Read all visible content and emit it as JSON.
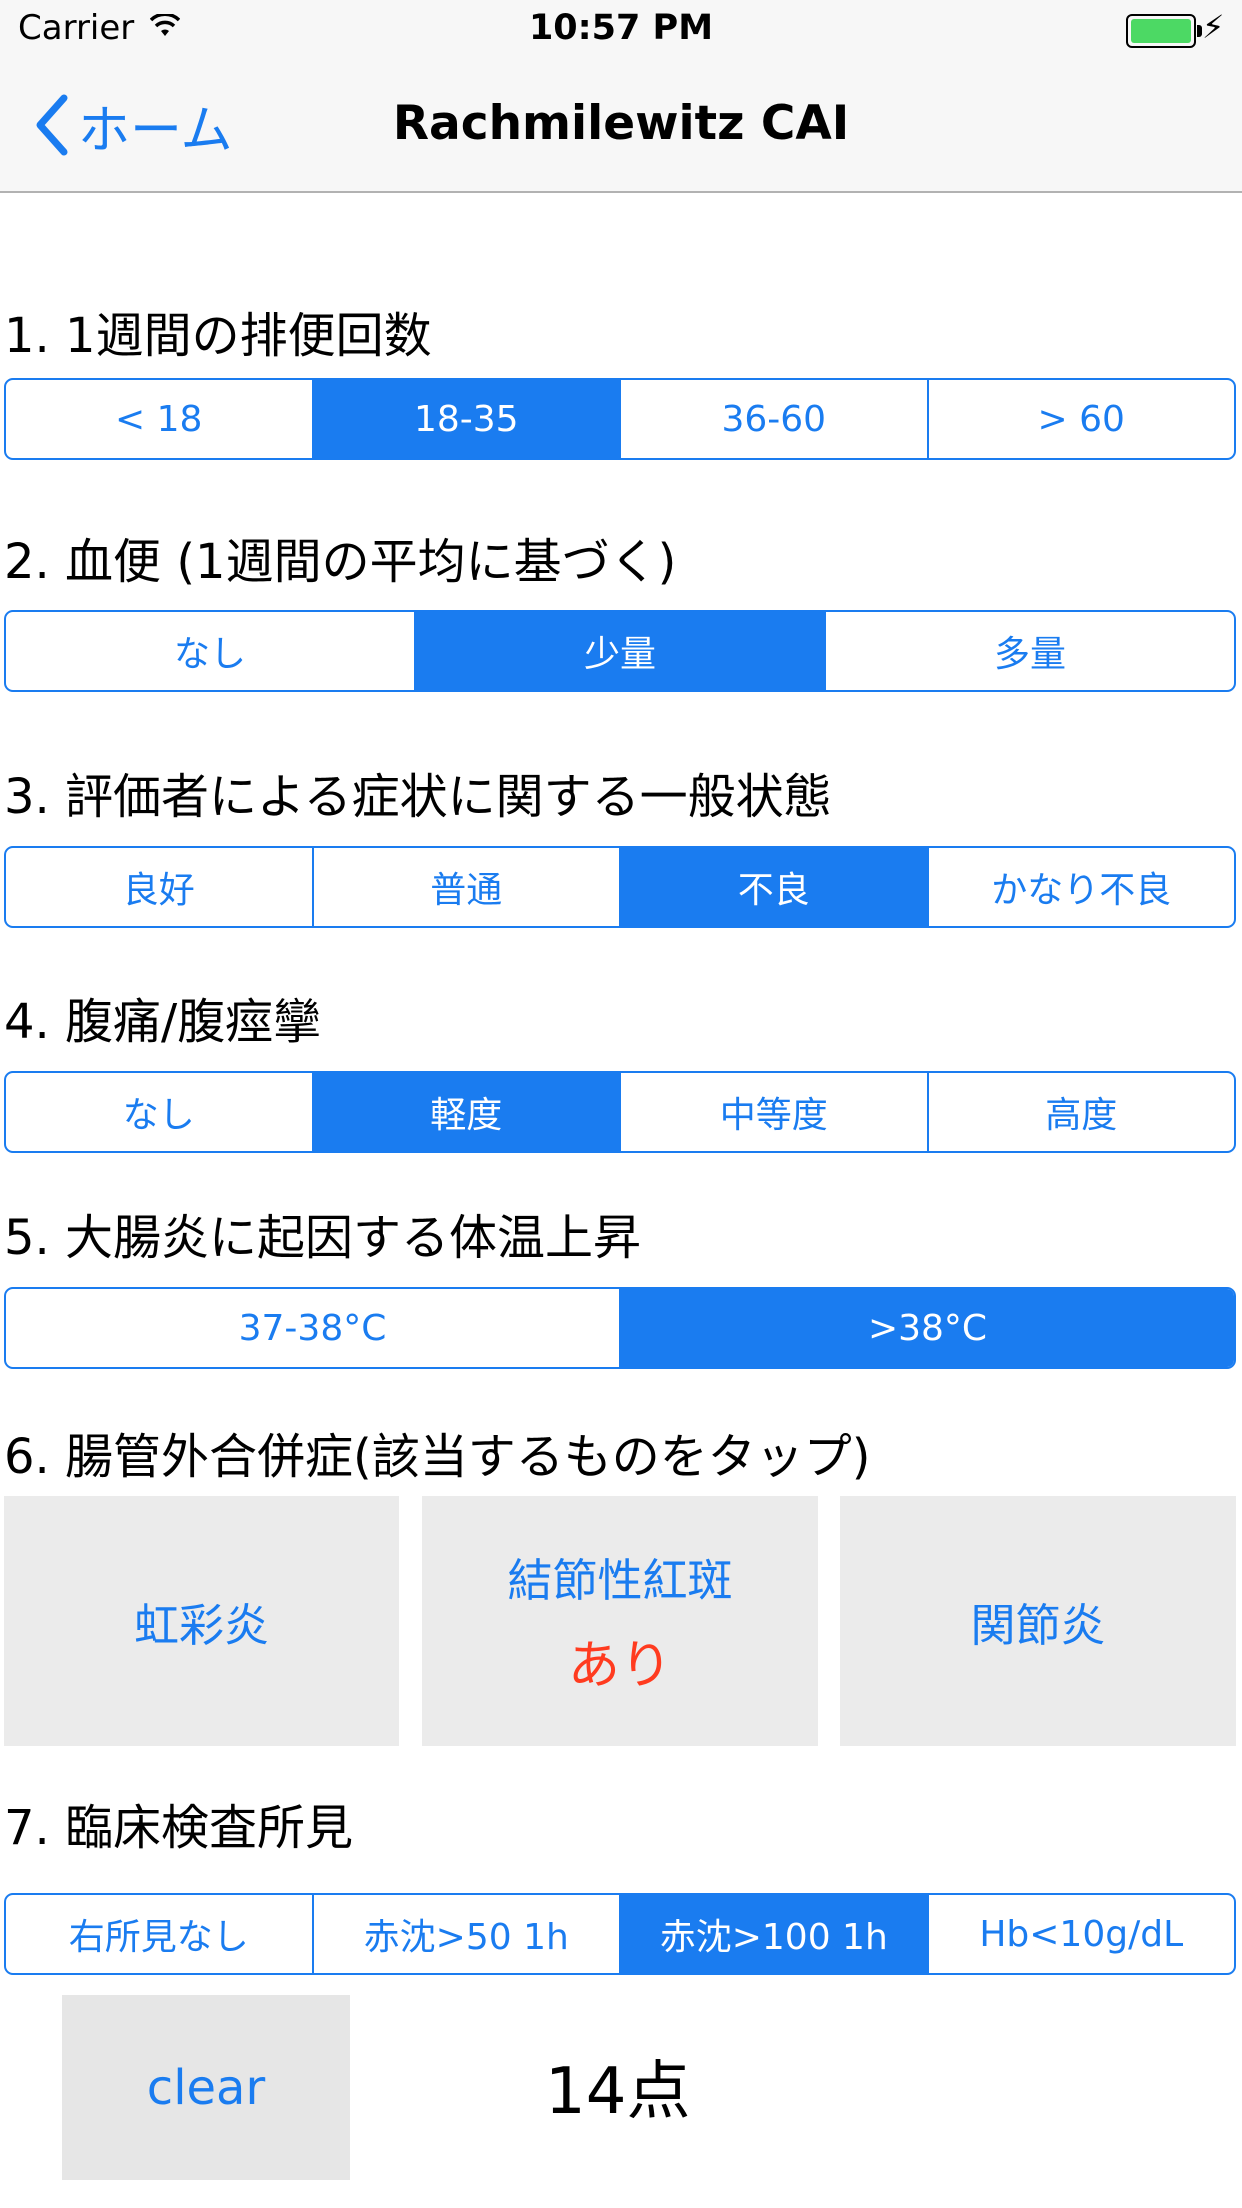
{
  "status": {
    "carrier": "Carrier",
    "time": "10:57 PM"
  },
  "nav": {
    "back_label": "ホーム",
    "title": "Rachmilewitz CAI"
  },
  "questions": [
    {
      "label": "1. 1週間の排便回数",
      "options": [
        "< 18",
        "18-35",
        "36-60",
        "> 60"
      ],
      "selected": 1
    },
    {
      "label": "2. 血便 (1週間の平均に基づく)",
      "options": [
        "なし",
        "少量",
        "多量"
      ],
      "selected": 1
    },
    {
      "label": "3. 評価者による症状に関する一般状態",
      "options": [
        "良好",
        "普通",
        "不良",
        "かなり不良"
      ],
      "selected": 2
    },
    {
      "label": "4. 腹痛/腹痙攣",
      "options": [
        "なし",
        "軽度",
        "中等度",
        "高度"
      ],
      "selected": 1
    },
    {
      "label": "5. 大腸炎に起因する体温上昇",
      "options": [
        "37-38°C",
        ">38°C"
      ],
      "selected": 1
    }
  ],
  "complications": {
    "label": "6. 腸管外合併症(該当するものをタップ)",
    "items": [
      {
        "name": "虹彩炎",
        "state": ""
      },
      {
        "name": "結節性紅斑",
        "state": "あり"
      },
      {
        "name": "関節炎",
        "state": ""
      }
    ]
  },
  "labs": {
    "label": "7. 臨床検査所見",
    "options": [
      "右所見なし",
      "赤沈>50 1h",
      "赤沈>100 1h",
      "Hb<10g/dL"
    ],
    "selected": 2
  },
  "footer": {
    "clear_label": "clear",
    "score": "14点"
  },
  "colors": {
    "accent": "#1a7cf0",
    "alert": "#ff3b1f",
    "tile": "#ebebeb"
  }
}
